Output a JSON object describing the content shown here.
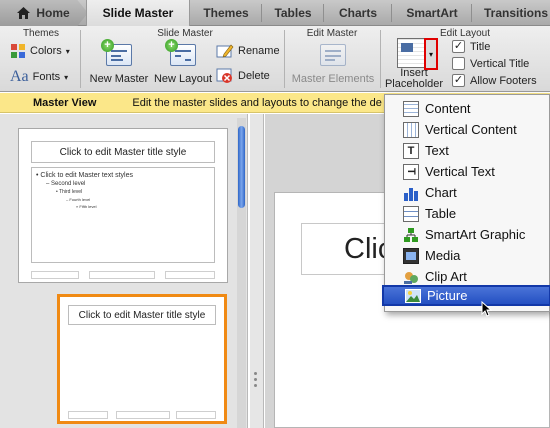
{
  "tabs": {
    "home": "Home",
    "slide_master": "Slide Master",
    "themes": "Themes",
    "tables": "Tables",
    "charts": "Charts",
    "smartart": "SmartArt",
    "transitions": "Transitions"
  },
  "ribbon": {
    "themes_group": "Themes",
    "colors": "Colors",
    "fonts": "Fonts",
    "fonts_icon_text": "Aa",
    "slide_master_group": "Slide Master",
    "new_master": "New Master",
    "new_layout": "New Layout",
    "rename": "Rename",
    "delete": "Delete",
    "edit_master_group": "Edit Master",
    "master_elements": "Master Elements",
    "edit_layout_group": "Edit Layout",
    "insert_placeholder_line1": "Insert",
    "insert_placeholder_line2": "Placeholder",
    "title_check": "Title",
    "vertical_title_check": "Vertical Title",
    "allow_footers_check": "Allow Footers"
  },
  "checks": {
    "title": true,
    "vertical_title": false,
    "allow_footers": true
  },
  "infobar": {
    "label": "Master View",
    "message": "Edit the master slides and layouts to change the de"
  },
  "thumbnails": {
    "master": {
      "title": "Click to edit Master title style",
      "levels": [
        "• Click to edit Master text styles",
        "– Second level",
        "• Third level",
        "– Fourth level",
        "» Fifth level"
      ]
    },
    "layout": {
      "title": "Click to edit Master title style"
    }
  },
  "main_slide": {
    "title_fragment": "Click to edit Mas"
  },
  "placeholder_menu": {
    "items": [
      {
        "label": "Content",
        "icon": "content-icon"
      },
      {
        "label": "Vertical Content",
        "icon": "vertical-content-icon"
      },
      {
        "label": "Text",
        "icon": "text-icon"
      },
      {
        "label": "Vertical Text",
        "icon": "vertical-text-icon"
      },
      {
        "label": "Chart",
        "icon": "chart-icon"
      },
      {
        "label": "Table",
        "icon": "table-icon"
      },
      {
        "label": "SmartArt Graphic",
        "icon": "smartart-icon"
      },
      {
        "label": "Media",
        "icon": "media-icon"
      },
      {
        "label": "Clip Art",
        "icon": "clip-art-icon"
      },
      {
        "label": "Picture",
        "icon": "picture-icon"
      }
    ],
    "selected": "Picture"
  },
  "colors": {
    "accent_orange": "#f08a14",
    "menu_highlight": "#2450c2",
    "infobar_bg": "#fbe789",
    "callout_red": "#e00000"
  }
}
